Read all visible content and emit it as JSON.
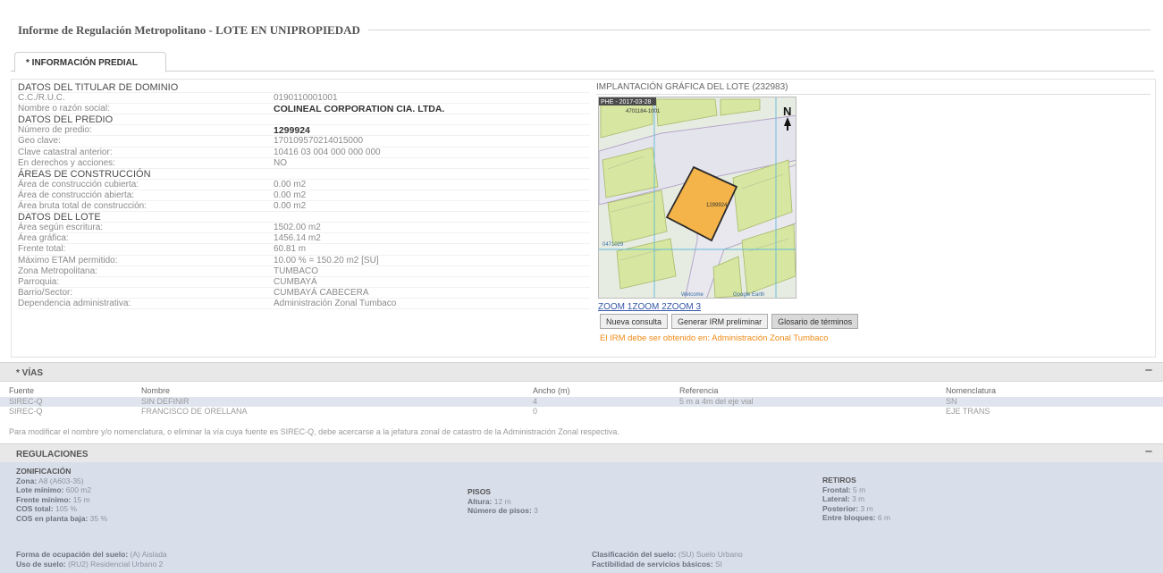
{
  "header": {
    "title": "Informe de Regulación Metropolitano - LOTE EN UNIPROPIEDAD"
  },
  "tabs": [
    {
      "label": "* INFORMACIÓN PREDIAL"
    }
  ],
  "predial": {
    "rows": [
      {
        "label": "DATOS DEL TITULAR DE DOMINIO",
        "value": "",
        "type": "section"
      },
      {
        "label": "C.C./R.U.C.",
        "value": "0190110001001",
        "type": "normal"
      },
      {
        "label": "Nombre o razón social:",
        "value": "COLINEAL CORPORATION CIA. LTDA.",
        "type": "strong"
      },
      {
        "label": "DATOS DEL PREDIO",
        "value": "",
        "type": "section"
      },
      {
        "label": "Número de predio:",
        "value": "1299924",
        "type": "strong"
      },
      {
        "label": "Geo clave:",
        "value": "170109570214015000",
        "type": "normal"
      },
      {
        "label": "Clave catastral anterior:",
        "value": "10416 03 004 000 000 000",
        "type": "normal"
      },
      {
        "label": "En derechos y acciones:",
        "value": "NO",
        "type": "normal"
      },
      {
        "label": "ÁREAS DE CONSTRUCCIÓN",
        "value": "",
        "type": "section"
      },
      {
        "label": "Área de construcción cubierta:",
        "value": "0.00 m2",
        "type": "normal"
      },
      {
        "label": "Área de construcción abierta:",
        "value": "0.00 m2",
        "type": "normal"
      },
      {
        "label": "Área bruta total de construcción:",
        "value": "0.00 m2",
        "type": "normal"
      },
      {
        "label": "DATOS DEL LOTE",
        "value": "",
        "type": "section"
      },
      {
        "label": "Área según escritura:",
        "value": "1502.00 m2",
        "type": "normal"
      },
      {
        "label": "Área gráfica:",
        "value": "1456.14 m2",
        "type": "normal"
      },
      {
        "label": "Frente total:",
        "value": "60.81 m",
        "type": "normal"
      },
      {
        "label": "Máximo ETAM permitido:",
        "value": "10.00 % = 150.20 m2 [SU]",
        "type": "normal"
      },
      {
        "label": "Zona Metropolitana:",
        "value": "TUMBACO",
        "type": "normal"
      },
      {
        "label": "Parroquia:",
        "value": "CUMBAYÁ",
        "type": "normal"
      },
      {
        "label": "Barrio/Sector:",
        "value": "CUMBAYÁ CABECERA",
        "type": "normal"
      },
      {
        "label": "Dependencia administrativa:",
        "value": "Administración Zonal Tumbaco",
        "type": "normal"
      }
    ]
  },
  "map": {
    "header": "IMPLANTACIÓN GRÁFICA DEL LOTE (232983)",
    "top_label": "PHE - 2017-03-28",
    "lot_label_top": "4701184-1001",
    "lot_label_center": "1299924",
    "north_label": "N",
    "bottom_labels": [
      "Welcome",
      "Google Earth"
    ],
    "side_label": "0471029",
    "zoom_links": [
      "ZOOM 1",
      "ZOOM 2",
      "ZOOM 3"
    ],
    "buttons": {
      "new_query": "Nueva consulta",
      "generate": "Generar IRM preliminar",
      "glossary": "Glosario de términos"
    },
    "warning": "El IRM debe ser obtenido en: Administración Zonal Tumbaco",
    "colors": {
      "lot_fill": "#f5b44a",
      "lot_border": "#2b2b2b",
      "map_bg": "#e9efe6",
      "parcel": "#d7e6a0"
    }
  },
  "vias": {
    "title": "* VÍAS",
    "collapse_symbol": "−",
    "columns": [
      "Fuente",
      "Nombre",
      "Ancho (m)",
      "Referencia",
      "Nomenclatura"
    ],
    "rows": [
      [
        "SIREC-Q",
        "SIN DEFINIR",
        "4",
        "5 m a 4m del eje vial",
        "SN"
      ],
      [
        "SIREC-Q",
        "FRANCISCO DE ORELLANA",
        "0",
        "",
        "EJE TRANS"
      ]
    ],
    "note": "Para modificar el nombre y/o nomenclatura, o eliminar la vía cuya fuente es SIREC-Q, debe acercarse a la jefatura zonal de catastro de la Administración Zonal respectiva."
  },
  "regulaciones": {
    "title": "REGULACIONES",
    "collapse_symbol": "−",
    "zonificacion": {
      "heading": "ZONIFICACIÓN",
      "items": [
        {
          "k": "Zona:",
          "v": "A8 (A603-35)"
        },
        {
          "k": "Lote mínimo:",
          "v": "600 m2"
        },
        {
          "k": "Frente mínimo:",
          "v": "15 m"
        },
        {
          "k": "COS total:",
          "v": "105 %"
        },
        {
          "k": "COS en planta baja:",
          "v": "35 %"
        }
      ]
    },
    "pisos": {
      "heading": "PISOS",
      "items": [
        {
          "k": "Altura:",
          "v": "12 m"
        },
        {
          "k": "Número de pisos:",
          "v": "3"
        }
      ]
    },
    "retiros": {
      "heading": "RETIROS",
      "items": [
        {
          "k": "Frontal:",
          "v": "5 m"
        },
        {
          "k": "Lateral:",
          "v": "3 m"
        },
        {
          "k": "Posterior:",
          "v": "3 m"
        },
        {
          "k": "Entre bloques:",
          "v": "6 m"
        }
      ]
    },
    "extra_left": [
      {
        "k": "Forma de ocupación del suelo:",
        "v": "(A) Aislada"
      },
      {
        "k": "Uso de suelo:",
        "v": "(RU2) Residencial Urbano 2"
      }
    ],
    "extra_right": [
      {
        "k": "Clasificación del suelo:",
        "v": "(SU) Suelo Urbano"
      },
      {
        "k": "Factibilidad de servicios básicos:",
        "v": "SI"
      }
    ]
  }
}
